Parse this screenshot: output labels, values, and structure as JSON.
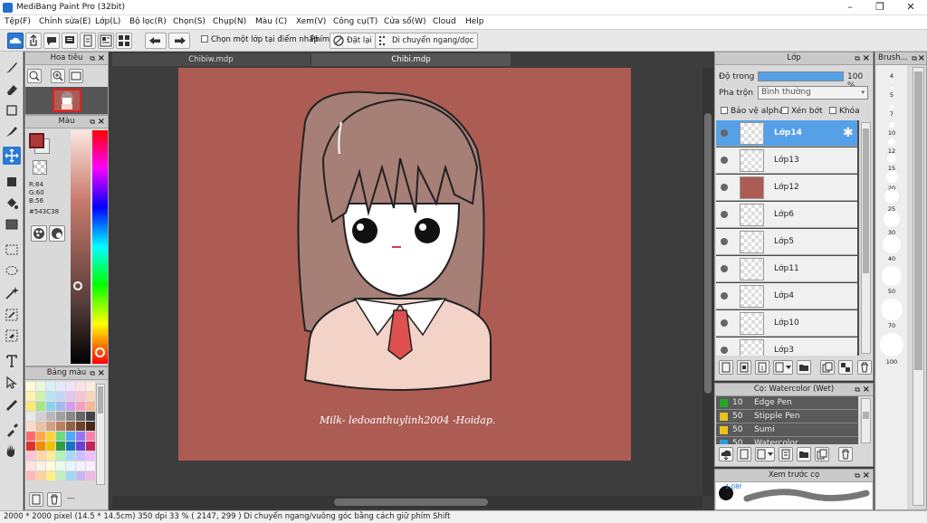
{
  "window": {
    "title": "MediBang Paint Pro (32bit)",
    "min": "–",
    "max": "❐",
    "close": "✕"
  },
  "menu": [
    "Tệp(F)",
    "Chỉnh sửa(E)",
    "Lớp(L)",
    "Bộ lọc(R)",
    "Chọn(S)",
    "Chụp(N)",
    "Màu (C)",
    "Xem(V)",
    "Công cụ(T)",
    "Cửa sổ(W)",
    "Cloud",
    "Help"
  ],
  "toolbar": {
    "select_layer_label": "Chọn một lớp tại điểm nhấp",
    "key_label": "Phím",
    "reset_label": "Đặt lại",
    "move_label": "Di chuyển ngang/dọc"
  },
  "navigator": {
    "title": "Hoa tiêu"
  },
  "color_panel": {
    "title": "Màu",
    "r": "R:84",
    "g": "G:60",
    "b": "B:56",
    "hex": "#543C38",
    "primary": "#ac3a3a",
    "secondary": "#e6f2ef"
  },
  "palette_panel": {
    "title": "Bảng màu",
    "more": "---"
  },
  "tabs": [
    "Chibiw.mdp",
    "Chibi.mdp"
  ],
  "artwork": {
    "signature": "Milk- ledoanthuylinh2004 -Hoidap.",
    "bg": "#ac5c53"
  },
  "layer_panel": {
    "title": "Lớp",
    "opacity_label": "Độ trong",
    "opacity_value": "100 %",
    "opacity_fraction": 1.0,
    "blend_label": "Pha trộn",
    "blend_value": "Bình thường",
    "protect_alpha": "Bảo vệ alpha",
    "clip": "Xén bớt",
    "lock": "Khóa",
    "layers": [
      {
        "name": "Lớp14",
        "selected": true
      },
      {
        "name": "Lớp13",
        "selected": false
      },
      {
        "name": "Lớp12",
        "selected": false
      },
      {
        "name": "Lớp6",
        "selected": false
      },
      {
        "name": "Lớp5",
        "selected": false
      },
      {
        "name": "Lớp11",
        "selected": false
      },
      {
        "name": "Lớp4",
        "selected": false
      },
      {
        "name": "Lớp10",
        "selected": false
      },
      {
        "name": "Lớp3",
        "selected": false
      }
    ]
  },
  "brush_panel": {
    "title": "Cọ: Watercolor (Wet)",
    "brushes": [
      {
        "size": "10",
        "name": "Edge Pen",
        "color": "#22aa22"
      },
      {
        "size": "50",
        "name": "Stipple Pen",
        "color": "#e6c21a"
      },
      {
        "size": "50",
        "name": "Sumi",
        "color": "#e6c21a"
      },
      {
        "size": "50",
        "name": "Watercolor",
        "color": "#2a9ee0"
      }
    ]
  },
  "brush_preview": {
    "title": "Xem trước cọ",
    "size": "1.08f"
  },
  "brush_size_panel": {
    "title": "Brush...",
    "sizes": [
      "4",
      "5",
      "7",
      "10",
      "12",
      "15",
      "20",
      "25",
      "30",
      "40",
      "50",
      "70",
      "100"
    ]
  },
  "statusbar": {
    "text": "2000 * 2000 pixel  (14.5 * 14.5cm)  350 dpi  33 %  ( 2147, 299 )  Di chuyển ngang/vuông góc bằng cách giữ phím Shift"
  }
}
